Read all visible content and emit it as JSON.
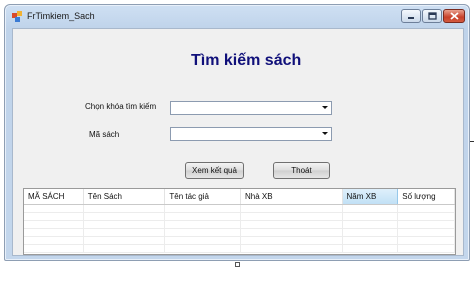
{
  "window": {
    "title": "FrTimkiem_Sach"
  },
  "form": {
    "heading": "Tìm kiếm sách",
    "search_key_label": "Chọn khóa tìm kiếm",
    "search_key_value": "",
    "book_id_label": "Mã sách",
    "book_id_value": "",
    "search_button": "Xem kết quả",
    "exit_button": "Thoát"
  },
  "grid": {
    "columns": [
      "MÃ SÁCH",
      "Tên Sách",
      "Tên tác giả",
      "Nhà XB",
      "Năm XB",
      "Số lượng"
    ],
    "selected_column": "Năm XB",
    "rows": []
  },
  "colors": {
    "heading": "#10107a",
    "selected_header": "#c1e0f5"
  }
}
